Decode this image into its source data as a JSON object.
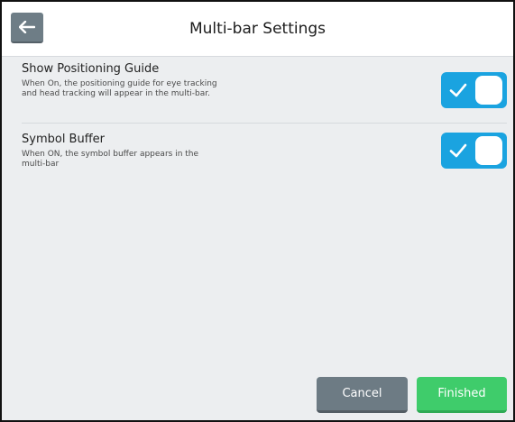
{
  "header": {
    "title": "Multi-bar Settings",
    "back_icon": "arrow-left-icon"
  },
  "settings": [
    {
      "title": "Show Positioning Guide",
      "description": "When On, the positioning guide for eye tracking and head tracking will appear in the multi-bar.",
      "enabled": true
    },
    {
      "title": "Symbol Buffer",
      "description": "When ON, the symbol buffer appears in the multi-bar",
      "enabled": true
    }
  ],
  "footer": {
    "cancel_label": "Cancel",
    "finished_label": "Finished"
  },
  "colors": {
    "toggle_on": "#1aa3e0",
    "cancel": "#6d7b84",
    "finished": "#3fcc6b",
    "background": "#eceef0",
    "header": "#ffffff"
  }
}
